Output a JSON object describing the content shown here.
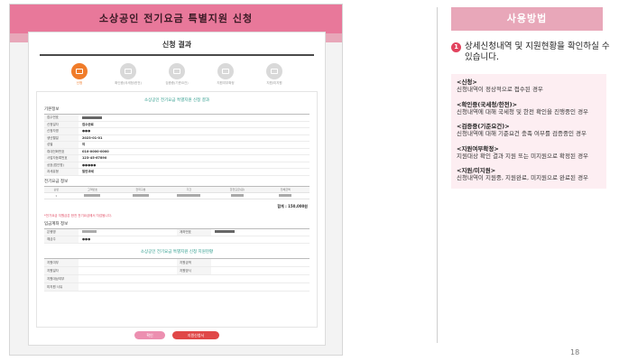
{
  "screenshot": {
    "header_title": "소상공인 전기요금 특별지원 신청",
    "card_title": "신청 결과",
    "steps": [
      {
        "label": "신청",
        "active": true
      },
      {
        "label": "확인중(국세청/한전)",
        "active": false
      },
      {
        "label": "검증중(기준요건)",
        "active": false
      },
      {
        "label": "지원여부확정",
        "active": false
      },
      {
        "label": "지원/미지원",
        "active": false
      }
    ],
    "section_heading": "소상공인 전기요금 특별지원 신청 결과",
    "basic_info_label": "기본정보",
    "basic_info": [
      {
        "key": "접수번호",
        "value": ""
      },
      {
        "key": "신청일자",
        "value": "접수완료"
      },
      {
        "key": "신청자명",
        "value": "●●●"
      },
      {
        "key": "생년월일",
        "value": "2023-01-01"
      },
      {
        "key": "성별",
        "value": "여"
      },
      {
        "key": "휴대전화번호",
        "value": "010-0000-0000"
      },
      {
        "key": "사업자등록번호",
        "value": "123-45-67890"
      },
      {
        "key": "상호(법인명)",
        "value": "●●●●●"
      },
      {
        "key": "과세유형",
        "value": "일반과세"
      }
    ],
    "elec_info_label": "전기요금 정보",
    "elec_headers": [
      "순번",
      "고객번호",
      "전력구분",
      "기간",
      "한전요금(원)",
      "전체금액"
    ],
    "elec_rows": [
      [
        "1",
        "",
        "",
        "",
        "",
        ""
      ]
    ],
    "total_text": "합계 : 150,000원",
    "notice_text": "*전기요금 지원금은 한전 전기요금에서 차감됩니다.",
    "payment_label": "입금계좌 정보",
    "payment_info": [
      {
        "key": "은행명",
        "value": "",
        "key2": "계좌번호",
        "value2": ""
      },
      {
        "key": "예금주",
        "value": "●●●",
        "key2": "",
        "value2": ""
      }
    ],
    "status_heading": "소상공인 전기요금 특별지원 신청 지원현황",
    "status_info": [
      {
        "key": "지원여부",
        "key2": "지원금액"
      },
      {
        "key": "지원일자",
        "key2": "지원방식"
      },
      {
        "key": "지원대상여부",
        "key2": ""
      },
      {
        "key": "미지원 사유",
        "key2": ""
      }
    ],
    "btn_confirm": "확인",
    "btn_print": "지원신청서"
  },
  "usage": {
    "header": "사용방법",
    "step_number": "1",
    "intro": "상세신청내역 및 지원현황을 확인하실 수 있습니다.",
    "definitions": [
      {
        "term": "<신청>",
        "desc": "신청내역이 정상적으로 접수된 경우"
      },
      {
        "term": "<확인중(국세청/한전)>",
        "desc": "신청내역에 대해 국세청 및 한전 확인을 진행중인 경우"
      },
      {
        "term": "<검증중(기준요건)>",
        "desc": "신청내역에 대해 기준요건 충족 여부를 검증중인 경우"
      },
      {
        "term": "<지원여부확정>",
        "desc": "지원대상 확인 결과 지원 또는 미지원으로 확정된 경우"
      },
      {
        "term": "<지원/미지원>",
        "desc": "신청내역이 지원중, 지원완료, 미지원으로 완료된 경우"
      }
    ]
  },
  "page_number": "18",
  "colors": {
    "pink_header": "#e8789a",
    "usage_header": "#e8a7b9",
    "active_step": "#f07c2a",
    "badge": "#e2435e"
  }
}
